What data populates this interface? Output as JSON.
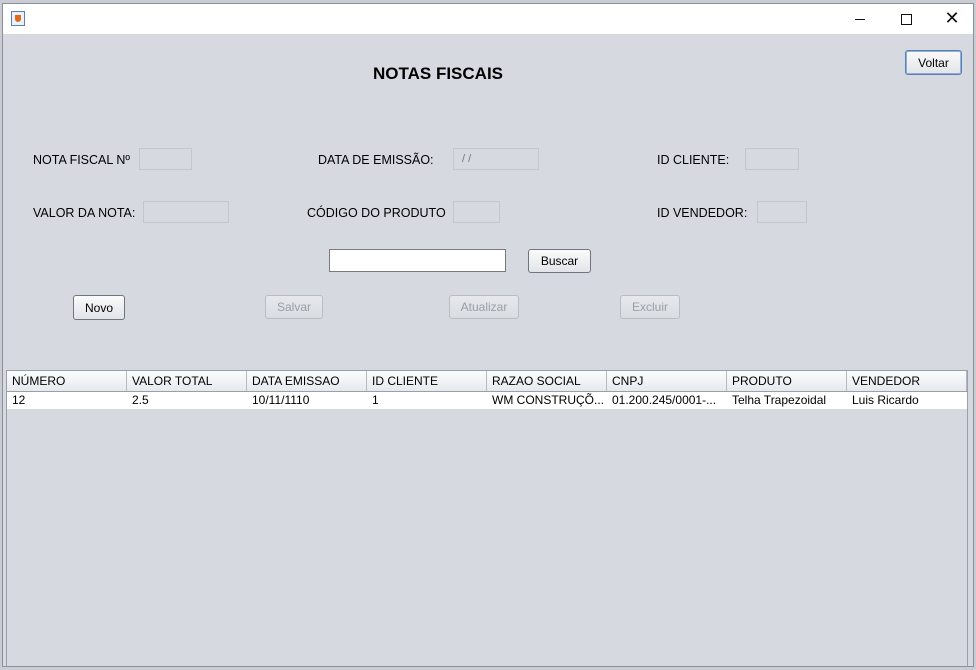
{
  "window": {
    "title": ""
  },
  "form": {
    "title": "NOTAS FISCAIS",
    "back_label": "Voltar",
    "labels": {
      "nota_fiscal": "NOTA FISCAL Nº",
      "data_emissao": "DATA DE EMISSÃO:",
      "id_cliente": "ID CLIENTE:",
      "valor_nota": "VALOR DA NOTA:",
      "codigo_produto": "CÓDIGO DO PRODUTO",
      "id_vendedor": "ID VENDEDOR:"
    },
    "values": {
      "nota_fiscal": "",
      "data_emissao": " /  /",
      "id_cliente": "",
      "valor_nota": "",
      "codigo_produto": "",
      "id_vendedor": "",
      "search": ""
    },
    "buttons": {
      "buscar": "Buscar",
      "novo": "Novo",
      "salvar": "Salvar",
      "atualizar": "Atualizar",
      "excluir": "Excluir"
    }
  },
  "table": {
    "columns": [
      "NÚMERO",
      "VALOR TOTAL",
      "DATA EMISSAO",
      "ID CLIENTE",
      "RAZAO SOCIAL",
      "CNPJ",
      "PRODUTO",
      "VENDEDOR"
    ],
    "rows": [
      [
        "12",
        "2.5",
        "10/11/1110",
        "1",
        "WM CONSTRUÇÕ...",
        "01.200.245/0001-...",
        "Telha Trapezoidal",
        "Luis Ricardo"
      ]
    ]
  }
}
